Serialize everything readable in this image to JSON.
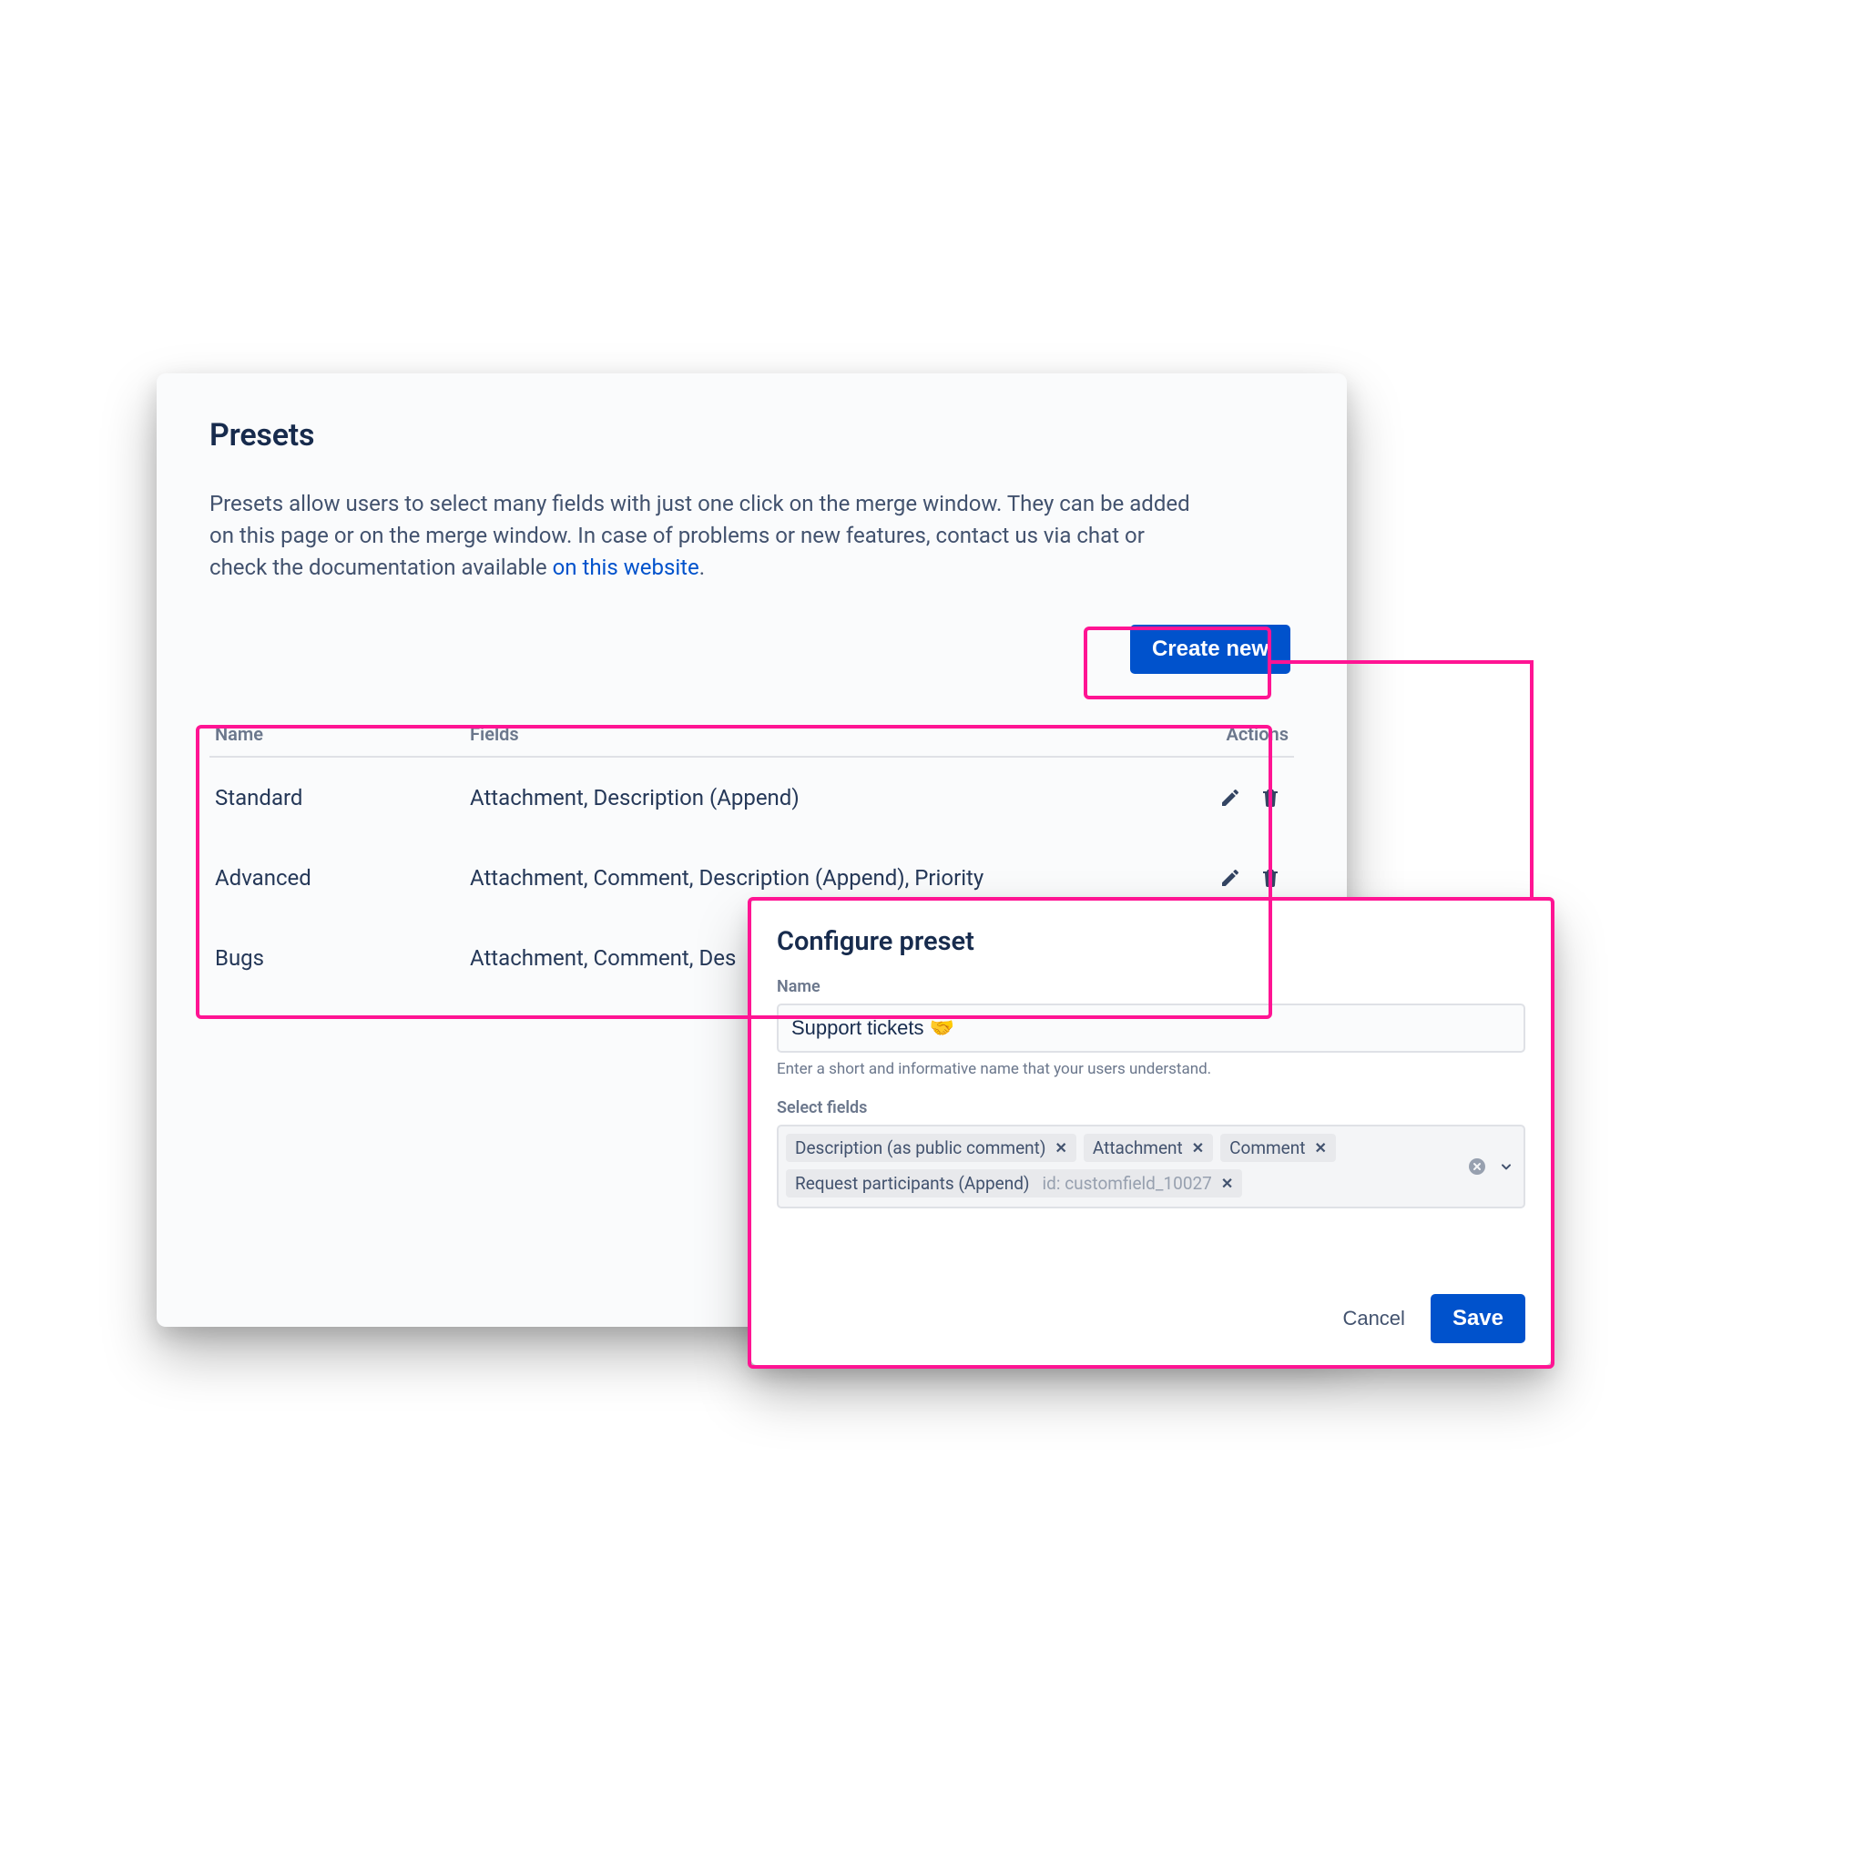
{
  "page": {
    "title": "Presets",
    "description_pre": "Presets allow users to select many fields with just one click on the merge window. They can be added on this page or on the merge window. In case of problems or new features, contact us via chat or check the documentation available ",
    "description_link": "on this website",
    "description_post": "."
  },
  "actions": {
    "create_new": "Create new"
  },
  "table": {
    "headers": {
      "name": "Name",
      "fields": "Fields",
      "actions": "Actions"
    },
    "rows": [
      {
        "name": "Standard",
        "fields": "Attachment, Description (Append)"
      },
      {
        "name": "Advanced",
        "fields": "Attachment, Comment, Description (Append), Priority"
      },
      {
        "name": "Bugs",
        "fields": "Attachment, Comment, Des"
      }
    ]
  },
  "dialog": {
    "title": "Configure preset",
    "name_label": "Name",
    "name_value": "Support tickets 🤝",
    "name_helper": "Enter a short and informative name that your users understand.",
    "select_label": "Select fields",
    "chips": [
      {
        "label": "Description (as public comment)",
        "hint": ""
      },
      {
        "label": "Attachment",
        "hint": ""
      },
      {
        "label": "Comment",
        "hint": ""
      },
      {
        "label": "Request participants (Append)",
        "hint": "id: customfield_10027"
      }
    ],
    "cancel": "Cancel",
    "save": "Save"
  }
}
